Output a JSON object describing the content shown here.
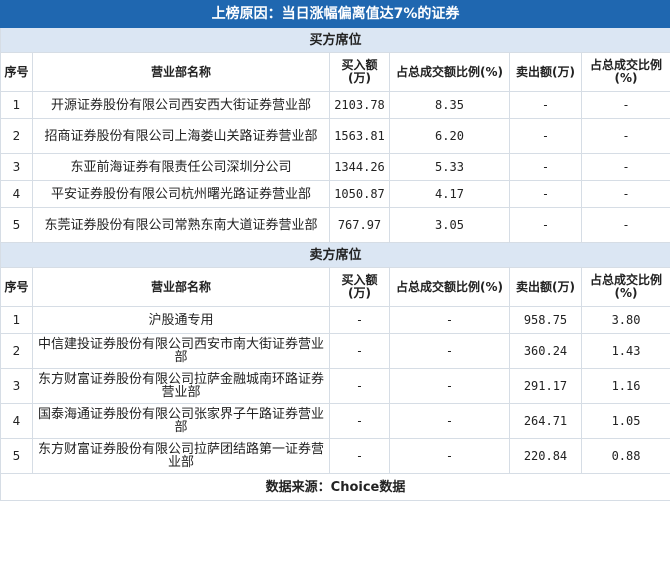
{
  "title": "上榜原因：当日涨幅偏离值达7%的证券",
  "buy_section": "买方席位",
  "sell_section": "卖方席位",
  "headers": {
    "index": "序号",
    "name": "营业部名称",
    "buy_amount": "买入额(万)",
    "buy_ratio": "占总成交额比例(%)",
    "sell_amount": "卖出额(万)",
    "sell_ratio": "占总成交比例(%)"
  },
  "buy_rows": [
    {
      "index": "1",
      "name": "开源证券股份有限公司西安西大街证券营业部",
      "buy_amount": "2103.78",
      "buy_ratio": "8.35",
      "sell_amount": "-",
      "sell_ratio": "-"
    },
    {
      "index": "2",
      "name": "招商证券股份有限公司上海娄山关路证券营业部",
      "buy_amount": "1563.81",
      "buy_ratio": "6.20",
      "sell_amount": "-",
      "sell_ratio": "-"
    },
    {
      "index": "3",
      "name": "东亚前海证券有限责任公司深圳分公司",
      "buy_amount": "1344.26",
      "buy_ratio": "5.33",
      "sell_amount": "-",
      "sell_ratio": "-"
    },
    {
      "index": "4",
      "name": "平安证券股份有限公司杭州曙光路证券营业部",
      "buy_amount": "1050.87",
      "buy_ratio": "4.17",
      "sell_amount": "-",
      "sell_ratio": "-"
    },
    {
      "index": "5",
      "name": "东莞证券股份有限公司常熟东南大道证券营业部",
      "buy_amount": "767.97",
      "buy_ratio": "3.05",
      "sell_amount": "-",
      "sell_ratio": "-"
    }
  ],
  "sell_rows": [
    {
      "index": "1",
      "name": "沪股通专用",
      "buy_amount": "-",
      "buy_ratio": "-",
      "sell_amount": "958.75",
      "sell_ratio": "3.80"
    },
    {
      "index": "2",
      "name": "中信建投证券股份有限公司西安市南大街证券营业部",
      "buy_amount": "-",
      "buy_ratio": "-",
      "sell_amount": "360.24",
      "sell_ratio": "1.43"
    },
    {
      "index": "3",
      "name": "东方财富证券股份有限公司拉萨金融城南环路证券营业部",
      "buy_amount": "-",
      "buy_ratio": "-",
      "sell_amount": "291.17",
      "sell_ratio": "1.16"
    },
    {
      "index": "4",
      "name": "国泰海通证券股份有限公司张家界子午路证券营业部",
      "buy_amount": "-",
      "buy_ratio": "-",
      "sell_amount": "264.71",
      "sell_ratio": "1.05"
    },
    {
      "index": "5",
      "name": "东方财富证券股份有限公司拉萨团结路第一证券营业部",
      "buy_amount": "-",
      "buy_ratio": "-",
      "sell_amount": "220.84",
      "sell_ratio": "0.88"
    }
  ],
  "footer": "数据来源：Choice数据",
  "colors": {
    "title_bg": "#1f67b0",
    "section_bg": "#dbe6f3",
    "border": "#d6dde5"
  }
}
